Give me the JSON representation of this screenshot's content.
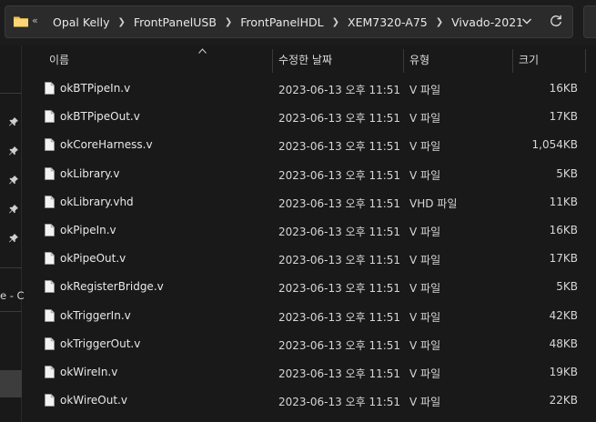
{
  "address_bar": {
    "overflow": "«",
    "breadcrumbs": [
      "Opal Kelly",
      "FrontPanelUSB",
      "FrontPanelHDL",
      "XEM7320-A75",
      "Vivado-2021"
    ]
  },
  "nav_pane": {
    "partial_item_label": "e - C"
  },
  "columns": {
    "name": "이름",
    "date": "수정한 날짜",
    "type": "유형",
    "size": "크기"
  },
  "files": [
    {
      "name": "okBTPipeIn.v",
      "date": "2023-06-13 오후 11:51",
      "type": "V 파일",
      "size": "16KB"
    },
    {
      "name": "okBTPipeOut.v",
      "date": "2023-06-13 오후 11:51",
      "type": "V 파일",
      "size": "17KB"
    },
    {
      "name": "okCoreHarness.v",
      "date": "2023-06-13 오후 11:51",
      "type": "V 파일",
      "size": "1,054KB"
    },
    {
      "name": "okLibrary.v",
      "date": "2023-06-13 오후 11:51",
      "type": "V 파일",
      "size": "5KB"
    },
    {
      "name": "okLibrary.vhd",
      "date": "2023-06-13 오후 11:51",
      "type": "VHD 파일",
      "size": "11KB"
    },
    {
      "name": "okPipeIn.v",
      "date": "2023-06-13 오후 11:51",
      "type": "V 파일",
      "size": "16KB"
    },
    {
      "name": "okPipeOut.v",
      "date": "2023-06-13 오후 11:51",
      "type": "V 파일",
      "size": "17KB"
    },
    {
      "name": "okRegisterBridge.v",
      "date": "2023-06-13 오후 11:51",
      "type": "V 파일",
      "size": "5KB"
    },
    {
      "name": "okTriggerIn.v",
      "date": "2023-06-13 오후 11:51",
      "type": "V 파일",
      "size": "42KB"
    },
    {
      "name": "okTriggerOut.v",
      "date": "2023-06-13 오후 11:51",
      "type": "V 파일",
      "size": "48KB"
    },
    {
      "name": "okWireIn.v",
      "date": "2023-06-13 오후 11:51",
      "type": "V 파일",
      "size": "19KB"
    },
    {
      "name": "okWireOut.v",
      "date": "2023-06-13 오후 11:51",
      "type": "V 파일",
      "size": "22KB"
    }
  ]
}
